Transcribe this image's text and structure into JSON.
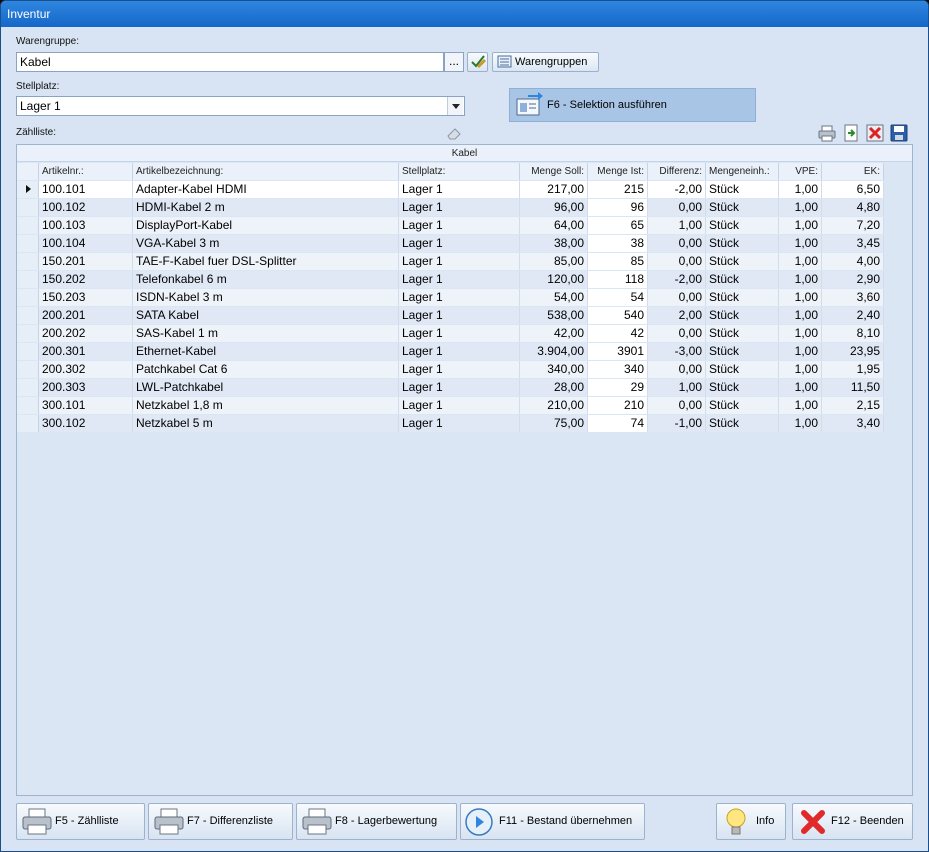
{
  "window": {
    "title": "Inventur"
  },
  "warengruppe": {
    "label": "Warengruppe:",
    "value": "Kabel",
    "ellipsis": "...",
    "button_label": "Warengruppen"
  },
  "stellplatz": {
    "label": "Stellplatz:",
    "value": "Lager 1"
  },
  "selection_button": {
    "label": "F6 - Selektion ausführen"
  },
  "zaehlliste": {
    "label": "Zählliste:"
  },
  "grid": {
    "group": "Kabel",
    "columns": [
      "Artikelnr.:",
      "Artikelbezeichnung:",
      "Stellplatz:",
      "Menge Soll:",
      "Menge Ist:",
      "Differenz:",
      "Mengeneinh.:",
      "VPE:",
      "EK:"
    ],
    "rows": [
      [
        "100.101",
        "Adapter-Kabel HDMI",
        "Lager 1",
        "217,00",
        "215",
        "-2,00",
        "Stück",
        "1,00",
        "6,50"
      ],
      [
        "100.102",
        "HDMI-Kabel 2 m",
        "Lager 1",
        "96,00",
        "96",
        "0,00",
        "Stück",
        "1,00",
        "4,80"
      ],
      [
        "100.103",
        "DisplayPort-Kabel",
        "Lager 1",
        "64,00",
        "65",
        "1,00",
        "Stück",
        "1,00",
        "7,20"
      ],
      [
        "100.104",
        "VGA-Kabel 3 m",
        "Lager 1",
        "38,00",
        "38",
        "0,00",
        "Stück",
        "1,00",
        "3,45"
      ],
      [
        "150.201",
        "TAE-F-Kabel fuer DSL-Splitter",
        "Lager 1",
        "85,00",
        "85",
        "0,00",
        "Stück",
        "1,00",
        "4,00"
      ],
      [
        "150.202",
        "Telefonkabel 6 m",
        "Lager 1",
        "120,00",
        "118",
        "-2,00",
        "Stück",
        "1,00",
        "2,90"
      ],
      [
        "150.203",
        "ISDN-Kabel 3 m",
        "Lager 1",
        "54,00",
        "54",
        "0,00",
        "Stück",
        "1,00",
        "3,60"
      ],
      [
        "200.201",
        "SATA Kabel",
        "Lager 1",
        "538,00",
        "540",
        "2,00",
        "Stück",
        "1,00",
        "2,40"
      ],
      [
        "200.202",
        "SAS-Kabel 1 m",
        "Lager 1",
        "42,00",
        "42",
        "0,00",
        "Stück",
        "1,00",
        "8,10"
      ],
      [
        "200.301",
        "Ethernet-Kabel",
        "Lager 1",
        "3.904,00",
        "3901",
        "-3,00",
        "Stück",
        "1,00",
        "23,95"
      ],
      [
        "200.302",
        "Patchkabel Cat 6",
        "Lager 1",
        "340,00",
        "340",
        "0,00",
        "Stück",
        "1,00",
        "1,95"
      ],
      [
        "200.303",
        "LWL-Patchkabel",
        "Lager 1",
        "28,00",
        "29",
        "1,00",
        "Stück",
        "1,00",
        "11,50"
      ],
      [
        "300.101",
        "Netzkabel 1,8 m",
        "Lager 1",
        "210,00",
        "210",
        "0,00",
        "Stück",
        "1,00",
        "2,15"
      ],
      [
        "300.102",
        "Netzkabel 5 m",
        "Lager 1",
        "75,00",
        "74",
        "-1,00",
        "Stück",
        "1,00",
        "3,40"
      ]
    ]
  },
  "footer": {
    "f5": "F5 - Zählliste",
    "f7": "F7 - Differenzliste",
    "f8": "F8 - Lagerbewertung",
    "f11": "F11 - Bestand übernehmen",
    "info": "Info",
    "f12": "F12 - Beenden"
  },
  "icons": {
    "toolbar": [
      "print-icon",
      "export-icon",
      "delete-icon",
      "save-icon"
    ]
  },
  "colors": {
    "titlebar": "#1567c8",
    "background": "#d8e4f3",
    "selection": "#a8c5e6"
  }
}
